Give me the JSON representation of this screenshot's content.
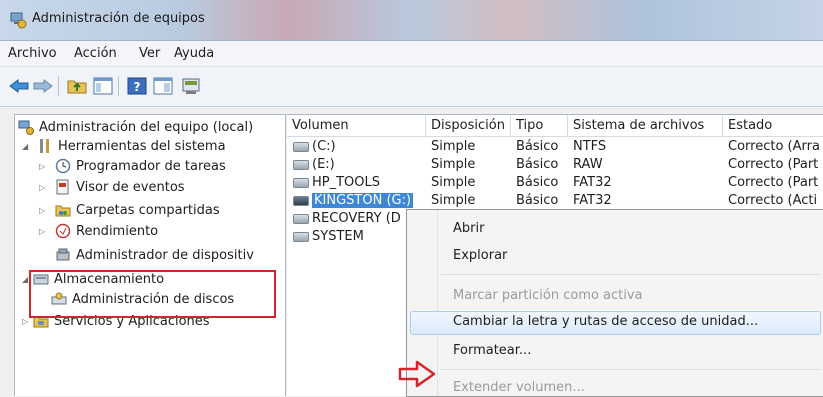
{
  "window": {
    "title": "Administración de equipos"
  },
  "menu": [
    "Archivo",
    "Acción",
    "Ver",
    "Ayuda"
  ],
  "toolbar_icons": [
    "back-arrow-icon",
    "forward-arrow-icon",
    "folder-up-icon",
    "show-hide-tree-icon",
    "help-icon",
    "properties-icon",
    "console-icon"
  ],
  "tree": {
    "root": "Administración del equipo (local)",
    "system_tools": "Herramientas del sistema",
    "task_scheduler": "Programador de tareas",
    "event_viewer": "Visor de eventos",
    "shared_folders": "Carpetas compartidas",
    "performance": "Rendimiento",
    "device_manager": "Administrador de dispositiv",
    "storage": "Almacenamiento",
    "disk_management": "Administración de discos",
    "services": "Servicios y Aplicaciones"
  },
  "columns": [
    "Volumen",
    "Disposición",
    "Tipo",
    "Sistema de archivos",
    "Estado"
  ],
  "rows": [
    [
      "(C:)",
      "Simple",
      "Básico",
      "NTFS",
      "Correcto (Arra"
    ],
    [
      "(E:)",
      "Simple",
      "Básico",
      "RAW",
      "Correcto (Part"
    ],
    [
      "HP_TOOLS",
      "Simple",
      "Básico",
      "FAT32",
      "Correcto (Part"
    ],
    [
      "KINGSTON (G:)",
      "Simple",
      "Básico",
      "FAT32",
      "Correcto (Acti"
    ],
    [
      "RECOVERY (D",
      "",
      "",
      "",
      ""
    ],
    [
      "SYSTEM",
      "",
      "",
      "",
      ""
    ]
  ],
  "context_menu": {
    "open": "Abrir",
    "explore": "Explorar",
    "mark_active": "Marcar partición como activa",
    "change_letter": "Cambiar la letra y rutas de acceso de unidad...",
    "format": "Formatear...",
    "extend": "Extender volumen..."
  },
  "colors": {
    "highlight": "#3e86d6",
    "annotation_red": "#d0262c"
  }
}
